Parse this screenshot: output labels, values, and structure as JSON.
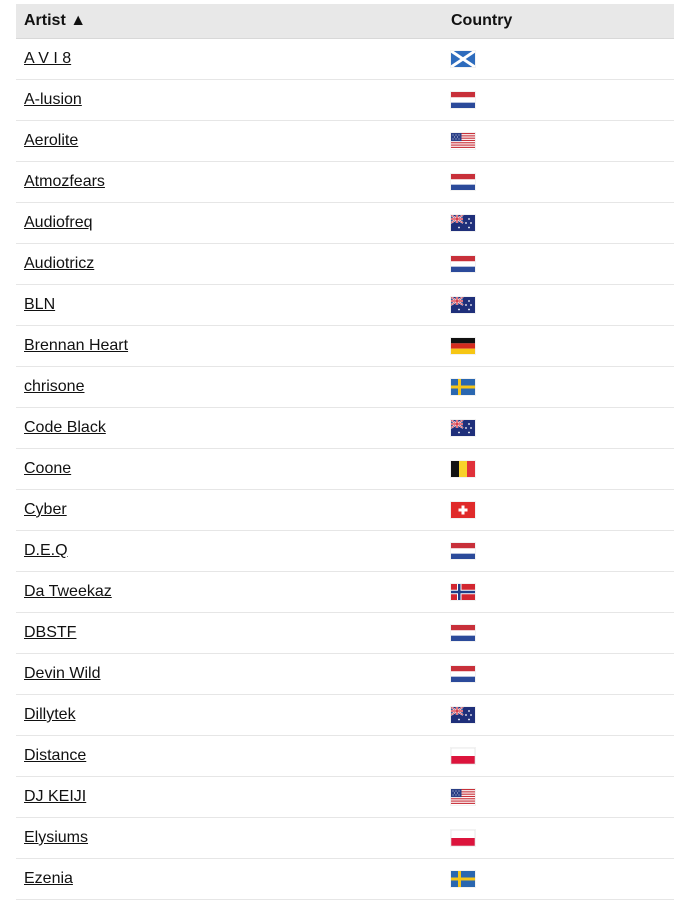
{
  "table": {
    "headers": {
      "artist": "Artist ▲",
      "country": "Country"
    },
    "rows": [
      {
        "artist": "A V I 8",
        "flag": "scotland"
      },
      {
        "artist": "A-lusion",
        "flag": "netherlands"
      },
      {
        "artist": "Aerolite",
        "flag": "usa"
      },
      {
        "artist": "Atmozfears",
        "flag": "netherlands"
      },
      {
        "artist": "Audiofreq",
        "flag": "australia"
      },
      {
        "artist": "Audiotricz",
        "flag": "netherlands"
      },
      {
        "artist": "BLN",
        "flag": "australia"
      },
      {
        "artist": "Brennan Heart",
        "flag": "germany"
      },
      {
        "artist": "chrisone",
        "flag": "sweden"
      },
      {
        "artist": "Code Black",
        "flag": "australia"
      },
      {
        "artist": "Coone",
        "flag": "belgium"
      },
      {
        "artist": "Cyber",
        "flag": "switzerland"
      },
      {
        "artist": "D.E.Q",
        "flag": "netherlands"
      },
      {
        "artist": "Da Tweekaz",
        "flag": "norway"
      },
      {
        "artist": "DBSTF",
        "flag": "netherlands"
      },
      {
        "artist": "Devin Wild",
        "flag": "netherlands"
      },
      {
        "artist": "Dillytek",
        "flag": "australia"
      },
      {
        "artist": "Distance",
        "flag": "poland"
      },
      {
        "artist": "DJ KEIJI",
        "flag": "usa"
      },
      {
        "artist": "Elysiums",
        "flag": "poland"
      },
      {
        "artist": "Ezenia",
        "flag": "sweden"
      }
    ]
  },
  "colors": {
    "header_bg": "#e8e8e8",
    "row_border": "#e6e6e6",
    "text": "#111111"
  }
}
